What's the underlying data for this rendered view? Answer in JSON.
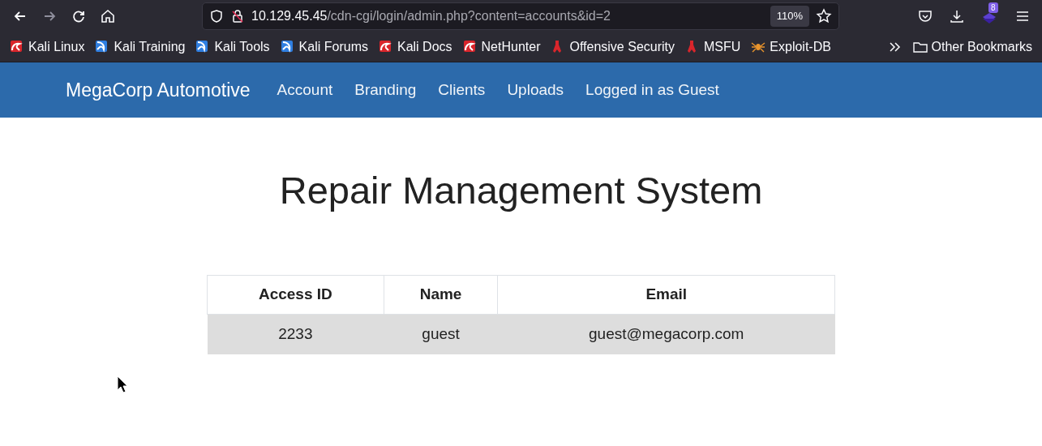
{
  "browser": {
    "url_host": "10.129.45.45",
    "url_path": "/cdn-cgi/login/admin.php?content=accounts&id=2",
    "zoom": "110%",
    "extension_badge": "8",
    "bookmarks": [
      {
        "label": "Kali Linux",
        "kind": "kali"
      },
      {
        "label": "Kali Training",
        "kind": "kali-blue"
      },
      {
        "label": "Kali Tools",
        "kind": "kali-blue"
      },
      {
        "label": "Kali Forums",
        "kind": "kali-blue"
      },
      {
        "label": "Kali Docs",
        "kind": "kali"
      },
      {
        "label": "NetHunter",
        "kind": "kali"
      },
      {
        "label": "Offensive Security",
        "kind": "offsec"
      },
      {
        "label": "MSFU",
        "kind": "offsec"
      },
      {
        "label": "Exploit-DB",
        "kind": "spider"
      }
    ],
    "other_bookmarks": "Other Bookmarks"
  },
  "navbar": {
    "brand": "MegaCorp Automotive",
    "links": [
      "Account",
      "Branding",
      "Clients",
      "Uploads",
      "Logged in as Guest"
    ]
  },
  "heading": "Repair Management System",
  "table": {
    "columns": [
      "Access ID",
      "Name",
      "Email"
    ],
    "rows": [
      [
        "2233",
        "guest",
        "guest@megacorp.com"
      ]
    ]
  }
}
